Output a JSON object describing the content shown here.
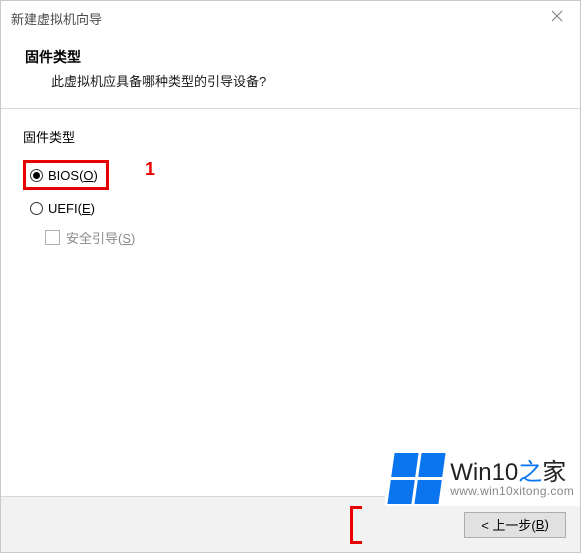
{
  "window": {
    "title": "新建虚拟机向导"
  },
  "header": {
    "title": "固件类型",
    "subtitle": "此虚拟机应具备哪种类型的引导设备?"
  },
  "group": {
    "label": "固件类型"
  },
  "options": {
    "bios": {
      "prefix": "BIOS(",
      "hotkey": "O",
      "suffix": ")",
      "selected": true
    },
    "uefi": {
      "prefix": "UEFI(",
      "hotkey": "E",
      "suffix": ")",
      "selected": false
    }
  },
  "secure_boot": {
    "prefix": "安全引导(",
    "hotkey": "S",
    "suffix": ")",
    "enabled": false
  },
  "marker": {
    "one": "1"
  },
  "buttons": {
    "back": {
      "prefix": "< 上一步(",
      "hotkey": "B",
      "suffix": ")"
    }
  },
  "watermark": {
    "brand_main": "Win10",
    "brand_zhi": "之",
    "brand_jia": "家",
    "url": "www.win10xitong.com"
  }
}
